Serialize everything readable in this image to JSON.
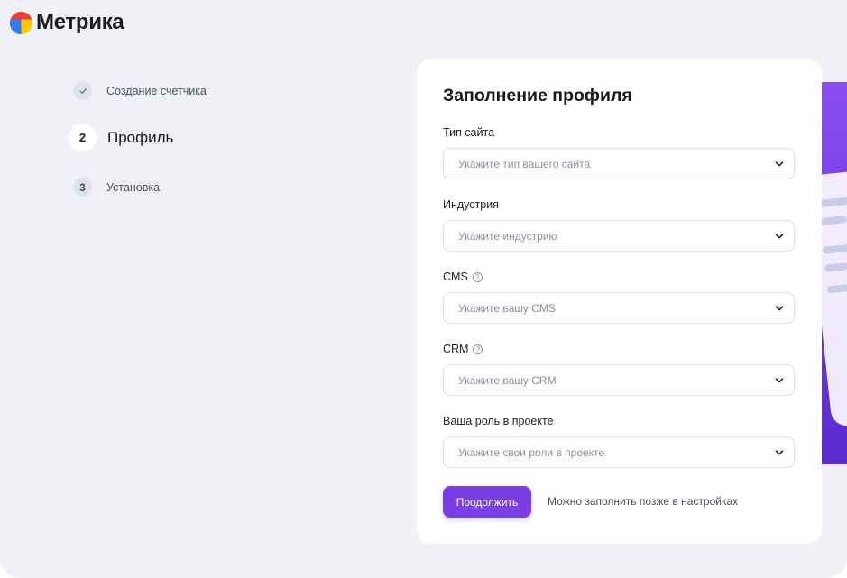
{
  "brand": {
    "name": "Метрика",
    "colors": [
      "#2f7cf6",
      "#ffcc00",
      "#ef3d3d"
    ]
  },
  "steps": [
    {
      "number": "",
      "label": "Создание счетчика",
      "state": "done",
      "icon": "check-icon"
    },
    {
      "number": "2",
      "label": "Профиль",
      "state": "active"
    },
    {
      "number": "3",
      "label": "Установка",
      "state": "pending"
    }
  ],
  "form": {
    "title": "Заполнение профиля",
    "fields": [
      {
        "label": "Тип сайта",
        "placeholder": "Укажите тип вашего сайта",
        "help": false
      },
      {
        "label": "Индустрия",
        "placeholder": "Укажите индустрию",
        "help": false
      },
      {
        "label": "CMS",
        "placeholder": "Укажите вашу CMS",
        "help": true
      },
      {
        "label": "CRM",
        "placeholder": "Укажите вашу CRM",
        "help": true
      },
      {
        "label": "Ваша роль в проекте",
        "placeholder": "Укажите свои роли в проекте",
        "help": false
      }
    ],
    "continue_label": "Продолжить",
    "later_text": "Можно заполнить позже в настройках"
  },
  "accent_color": "#7a3fe4"
}
